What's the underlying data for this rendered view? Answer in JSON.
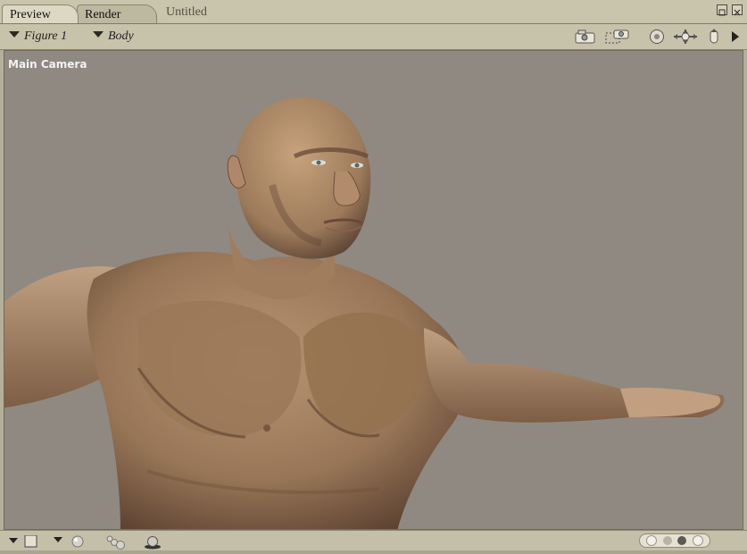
{
  "tabs": [
    {
      "label": "Preview",
      "active": true
    },
    {
      "label": "Render",
      "active": false
    }
  ],
  "document_title": "Untitled",
  "toolbar": {
    "figure_menu": "Figure 1",
    "body_menu": "Body",
    "icons": [
      "camera-icon",
      "render-area-icon",
      "trackball-icon",
      "move-xy-icon",
      "move-z-icon",
      "play-arrow-icon"
    ]
  },
  "viewport": {
    "camera_label": "Main Camera",
    "background_color": "#8f8982"
  },
  "bottom": {
    "icons": [
      "document-menu-icon",
      "lighting-sphere-icon",
      "multi-sphere-icon",
      "ground-shadow-icon"
    ],
    "display_dots": 4
  }
}
